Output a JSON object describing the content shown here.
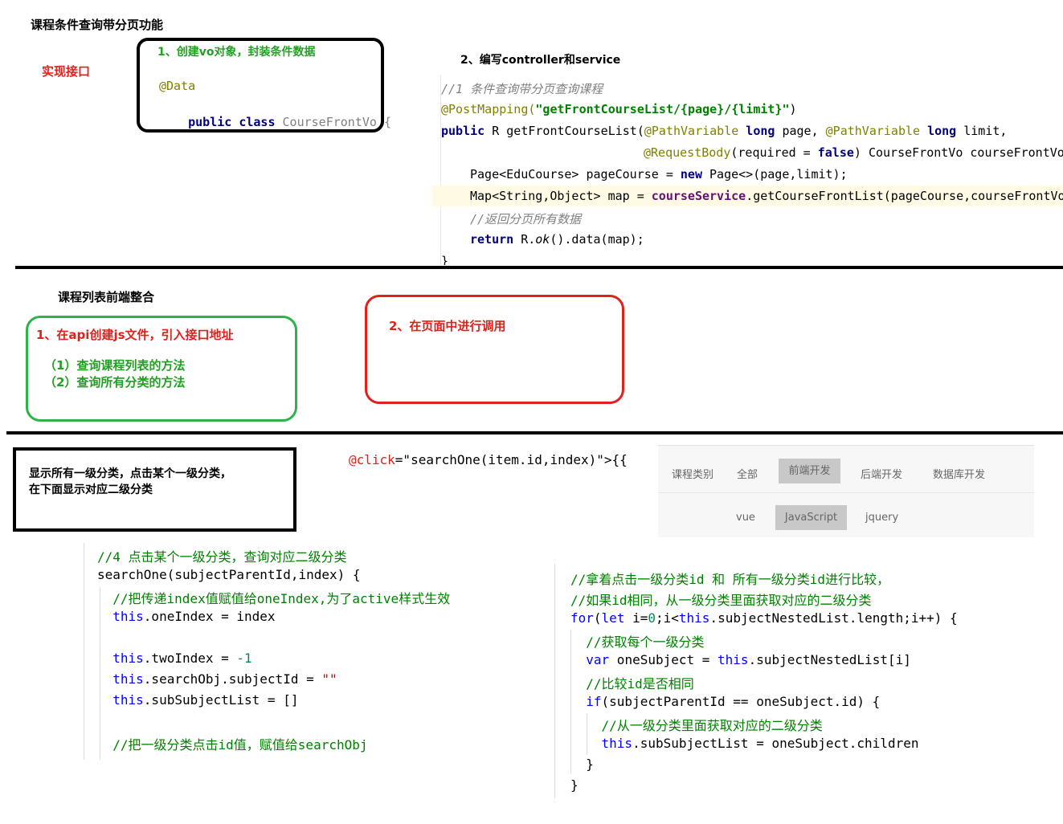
{
  "section1": {
    "title": "课程条件查询带分页功能",
    "implement_label": "实现接口",
    "step1": {
      "title": "1、创建vo对象，封装条件数据",
      "line1": "@Data",
      "line2_kw": "public class",
      "line2_name": " CourseFrontVo {"
    },
    "step2": {
      "title": "2、编写controller和service",
      "lines": {
        "l1": "//1 条件查询带分页查询课程",
        "l2_ann": "@PostMapping(",
        "l2_str": "\"getFrontCourseList/{page}/{limit}\"",
        "l2_end": ")",
        "l3_kw": "public",
        "l3_a": " R getFrontCourseList(",
        "l3_ann1": "@PathVariable",
        "l3_kw2": " long",
        "l3_b": " page, ",
        "l3_ann2": "@PathVariable",
        "l3_kw3": " long",
        "l3_c": " limit,",
        "l4_ann": "@RequestBody",
        "l4_a": "(required = ",
        "l4_kw": "false",
        "l4_b": ") CourseFrontVo courseFrontVo",
        "l5_a": "Page<EduCourse> pageCourse = ",
        "l5_kw": "new",
        "l5_b": " Page<>(page,limit);",
        "l6_a": "Map<String,Object> map = ",
        "l6_fld": "courseService",
        "l6_b": ".getCourseFrontList(pageCourse,courseFrontVo",
        "l7": "//返回分页所有数据",
        "l8_kw": "return",
        "l8_a": " R.",
        "l8_it": "ok",
        "l8_b": "().data(map);",
        "l9": "}"
      }
    }
  },
  "section2": {
    "title": "课程列表前端整合",
    "green_box": {
      "title": "1、在api创建js文件，引入接口地址",
      "item1": "（1）查询课程列表的方法",
      "item2": "（2）查询所有分类的方法"
    },
    "red_box": {
      "title": "2、在页面中进行调用"
    }
  },
  "section3": {
    "note_line1": "显示所有一级分类，点击某个一级分类，",
    "note_line2": "在下面显示对应二级分类",
    "click_code_attr": "@click",
    "click_code_rest": "=\"searchOne(item.id,index)\">{{",
    "category_panel": {
      "label": "课程类别",
      "level1": [
        "全部",
        "前端开发",
        "后端开发",
        "数据库开发"
      ],
      "level1_active": "前端开发",
      "level2": [
        "vue",
        "JavaScript",
        "jquery"
      ],
      "level2_active": "JavaScript"
    },
    "left_code": {
      "l1": "//4 点击某个一级分类，查询对应二级分类",
      "l2": "searchOne(subjectParentId,index) {",
      "l3": "  //把传递index值赋值给oneIndex,为了active样式生效",
      "l4_kw": "  this",
      "l4_rest": ".oneIndex = index",
      "l5_kw": "  this",
      "l5_a": ".twoIndex = ",
      "l5_num": "-1",
      "l6_kw": "  this",
      "l6_a": ".searchObj.subjectId = ",
      "l6_str": "\"\"",
      "l7_kw": "  this",
      "l7_rest": ".subSubjectList = []",
      "l8": "  //把一级分类点击id值，赋值给searchObj"
    },
    "right_code": {
      "l1": "//拿着点击一级分类id 和 所有一级分类id进行比较，",
      "l2": "//如果id相同，从一级分类里面获取对应的二级分类",
      "l3_kw": "for",
      "l3_a": "(",
      "l3_kw2": "let",
      "l3_b": " i=",
      "l3_num": "0",
      "l3_c": ";i<",
      "l3_kw3": "this",
      "l3_d": ".subjectNestedList.length;i++) {",
      "l4": "  //获取每个一级分类",
      "l5_kw": "  var",
      "l5_a": " oneSubject = ",
      "l5_kw2": "this",
      "l5_b": ".subjectNestedList[i]",
      "l6": "  //比较id是否相同",
      "l7_kw": "  if",
      "l7_rest": "(subjectParentId == oneSubject.id) {",
      "l8": "    //从一级分类里面获取对应的二级分类",
      "l9_kw": "    this",
      "l9_rest": ".subSubjectList = oneSubject.children",
      "l10": "  }",
      "l11": "}"
    }
  }
}
